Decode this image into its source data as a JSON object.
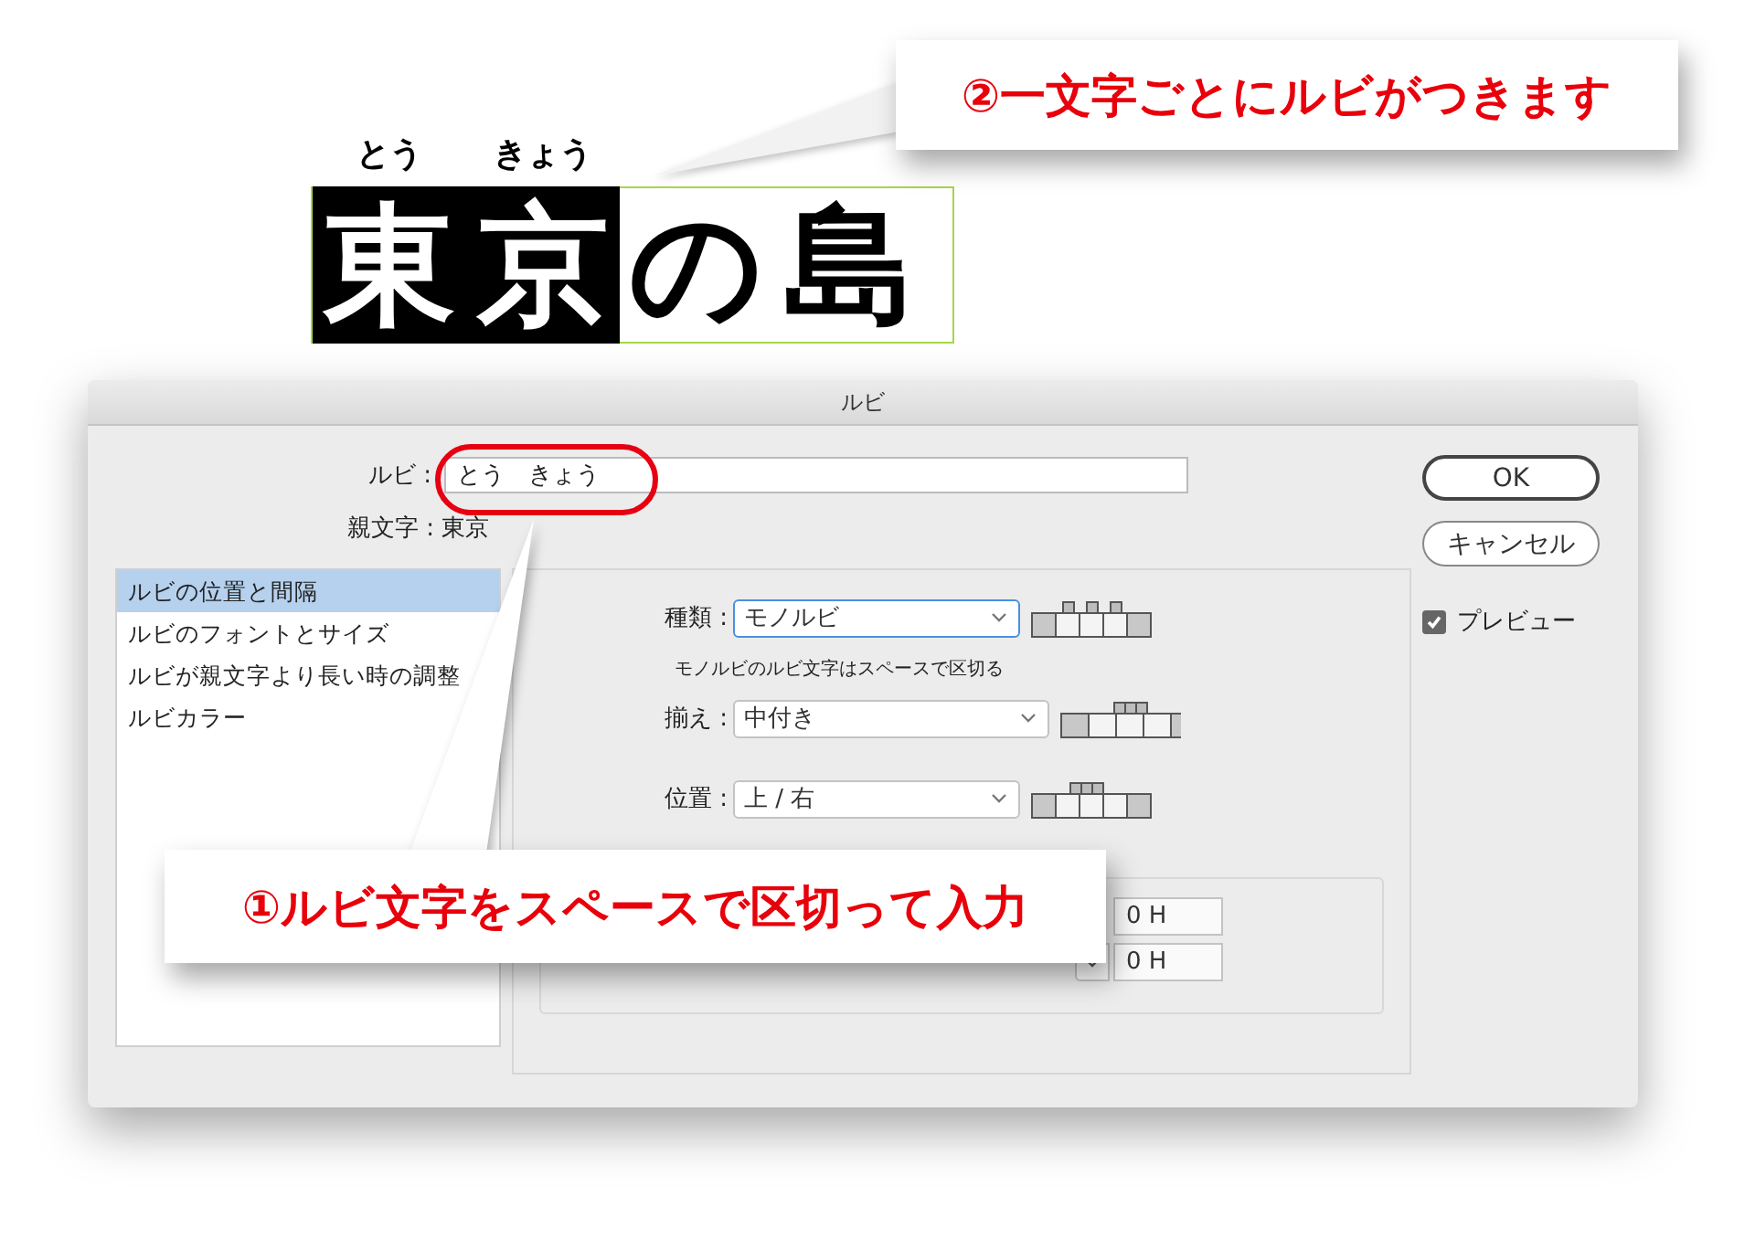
{
  "sample": {
    "characters": [
      {
        "base": "東",
        "ruby": "とう",
        "selected": true
      },
      {
        "base": "京",
        "ruby": "きょう",
        "selected": true
      },
      {
        "base": "の",
        "selected": false
      },
      {
        "base": "島",
        "selected": false
      }
    ]
  },
  "dialog": {
    "title": "ルビ",
    "ruby_field": {
      "label": "ルビ :",
      "value": "とう　きょう"
    },
    "base_text": "親文字 : 東京",
    "buttons": [
      {
        "label": "OK",
        "default": true
      },
      {
        "label": "キャンセル",
        "default": false
      }
    ],
    "preview": {
      "label": "プレビュー",
      "checked": true
    },
    "categories": [
      {
        "label": "ルビの位置と間隔",
        "selected": true
      },
      {
        "label": "ルビのフォントとサイズ",
        "selected": false
      },
      {
        "label": "ルビが親文字より長い時の調整",
        "selected": false
      },
      {
        "label": "ルビカラー",
        "selected": false
      }
    ],
    "settings": [
      {
        "label": "種類 :",
        "value": "モノルビ",
        "focused": true
      },
      {
        "label": "揃え :",
        "value": "中付き",
        "focused": false
      },
      {
        "label": "位置 :",
        "value": "上 / 右",
        "focused": false
      }
    ],
    "note": "モノルビのルビ文字はスペースで区切る",
    "offsets": [
      {
        "value": "0 H",
        "stepper": false
      },
      {
        "value": "0 H",
        "stepper": true
      }
    ]
  },
  "callouts": [
    {
      "text": "②一文字ごとにルビがつきます"
    },
    {
      "text": "①ルビ文字をスペースで区切って入力"
    }
  ]
}
